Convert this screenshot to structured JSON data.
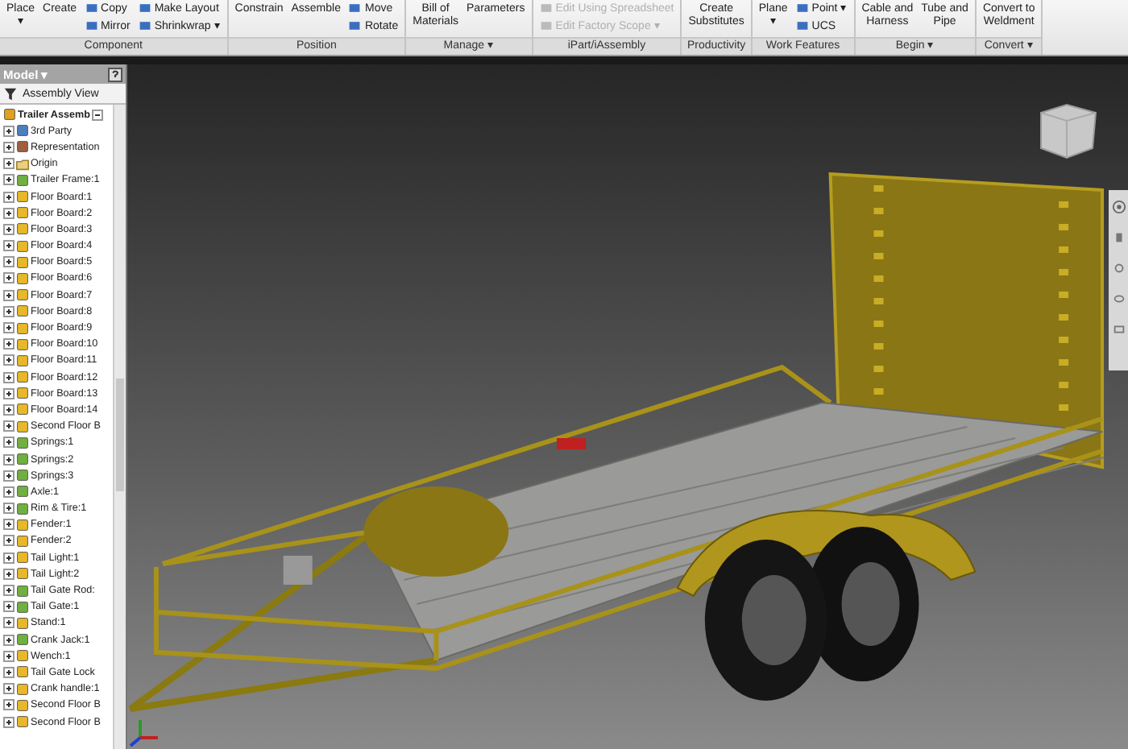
{
  "ribbon": {
    "panels": [
      {
        "label": "Component",
        "tools": [
          {
            "kind": "large",
            "label": "Place\n▾"
          },
          {
            "kind": "large",
            "label": "Create"
          },
          {
            "kind": "stack",
            "items": [
              {
                "label": "Copy",
                "disabled": false
              },
              {
                "label": "Mirror",
                "disabled": false
              }
            ]
          },
          {
            "kind": "stack",
            "items": [
              {
                "label": "Make Layout",
                "disabled": false
              },
              {
                "label": "Shrinkwrap ▾",
                "disabled": false
              }
            ]
          }
        ]
      },
      {
        "label": "Position",
        "tools": [
          {
            "kind": "large",
            "label": "Constrain"
          },
          {
            "kind": "large",
            "label": "Assemble"
          },
          {
            "kind": "stack",
            "items": [
              {
                "label": "Move",
                "disabled": false
              },
              {
                "label": "Rotate",
                "disabled": false
              }
            ]
          }
        ]
      },
      {
        "label": "Manage ▾",
        "tools": [
          {
            "kind": "large",
            "label": "Bill of\nMaterials"
          },
          {
            "kind": "large",
            "label": "Parameters"
          }
        ]
      },
      {
        "label": "iPart/iAssembly",
        "tools": [
          {
            "kind": "stack",
            "items": [
              {
                "label": "Edit Using Spreadsheet",
                "disabled": true
              },
              {
                "label": "Edit Factory Scope ▾",
                "disabled": true
              }
            ]
          }
        ]
      },
      {
        "label": "Productivity",
        "tools": [
          {
            "kind": "large",
            "label": "Create\nSubstitutes"
          }
        ]
      },
      {
        "label": "Work Features",
        "tools": [
          {
            "kind": "large",
            "label": "Plane\n▾"
          },
          {
            "kind": "stack",
            "items": [
              {
                "label": "Point ▾",
                "disabled": false
              },
              {
                "label": "UCS",
                "disabled": false
              }
            ]
          }
        ]
      },
      {
        "label": "Begin ▾",
        "tools": [
          {
            "kind": "large",
            "label": "Cable and\nHarness"
          },
          {
            "kind": "large",
            "label": "Tube and\nPipe"
          }
        ]
      },
      {
        "label": "Convert ▾",
        "tools": [
          {
            "kind": "large",
            "label": "Convert to\nWeldment"
          }
        ]
      }
    ]
  },
  "browser": {
    "title": "Model ▾",
    "view_button": "Assembly View",
    "tree": {
      "label": "Trailer Assemb",
      "kind": "assembly",
      "expanded": true,
      "children": [
        {
          "label": "3rd Party",
          "kind": "thirdparty",
          "expanded": false
        },
        {
          "label": "Representation",
          "kind": "representation",
          "expanded": false
        },
        {
          "label": "Origin",
          "kind": "folder",
          "expanded": false
        },
        {
          "label": "Trailer Frame:1",
          "kind": "weldment",
          "expanded": false
        },
        {
          "label": "Floor Board:1",
          "kind": "part",
          "expanded": false
        },
        {
          "label": "Floor Board:2",
          "kind": "part",
          "expanded": false
        },
        {
          "label": "Floor Board:3",
          "kind": "part",
          "expanded": false
        },
        {
          "label": "Floor Board:4",
          "kind": "part",
          "expanded": false
        },
        {
          "label": "Floor Board:5",
          "kind": "part",
          "expanded": false
        },
        {
          "label": "Floor Board:6",
          "kind": "part",
          "expanded": false
        },
        {
          "label": "Floor Board:7",
          "kind": "part",
          "expanded": false
        },
        {
          "label": "Floor Board:8",
          "kind": "part",
          "expanded": false
        },
        {
          "label": "Floor Board:9",
          "kind": "part",
          "expanded": false
        },
        {
          "label": "Floor Board:10",
          "kind": "part",
          "expanded": false
        },
        {
          "label": "Floor Board:11",
          "kind": "part",
          "expanded": false
        },
        {
          "label": "Floor Board:12",
          "kind": "part",
          "expanded": false
        },
        {
          "label": "Floor Board:13",
          "kind": "part",
          "expanded": false
        },
        {
          "label": "Floor Board:14",
          "kind": "part",
          "expanded": false
        },
        {
          "label": "Second Floor B",
          "kind": "part",
          "expanded": false
        },
        {
          "label": "Springs:1",
          "kind": "weldment",
          "expanded": false
        },
        {
          "label": "Springs:2",
          "kind": "weldment",
          "expanded": false
        },
        {
          "label": "Springs:3",
          "kind": "weldment",
          "expanded": false
        },
        {
          "label": "Axle:1",
          "kind": "weldment",
          "expanded": false
        },
        {
          "label": "Rim & Tire:1",
          "kind": "weldment",
          "expanded": false
        },
        {
          "label": "Fender:1",
          "kind": "part",
          "expanded": false
        },
        {
          "label": "Fender:2",
          "kind": "part",
          "expanded": false
        },
        {
          "label": "Tail Light:1",
          "kind": "part",
          "expanded": false
        },
        {
          "label": "Tail Light:2",
          "kind": "part",
          "expanded": false
        },
        {
          "label": "Tail Gate Rod:",
          "kind": "weldment",
          "expanded": false
        },
        {
          "label": "Tail Gate:1",
          "kind": "weldment",
          "expanded": false
        },
        {
          "label": "Stand:1",
          "kind": "part",
          "expanded": false
        },
        {
          "label": "Crank Jack:1",
          "kind": "weldment",
          "expanded": false
        },
        {
          "label": "Wench:1",
          "kind": "part",
          "expanded": false
        },
        {
          "label": "Tail Gate  Lock",
          "kind": "part",
          "expanded": false
        },
        {
          "label": "Crank handle:1",
          "kind": "part",
          "expanded": false
        },
        {
          "label": "Second Floor B",
          "kind": "part",
          "expanded": false
        },
        {
          "label": "Second Floor B",
          "kind": "part",
          "expanded": false
        }
      ]
    }
  }
}
